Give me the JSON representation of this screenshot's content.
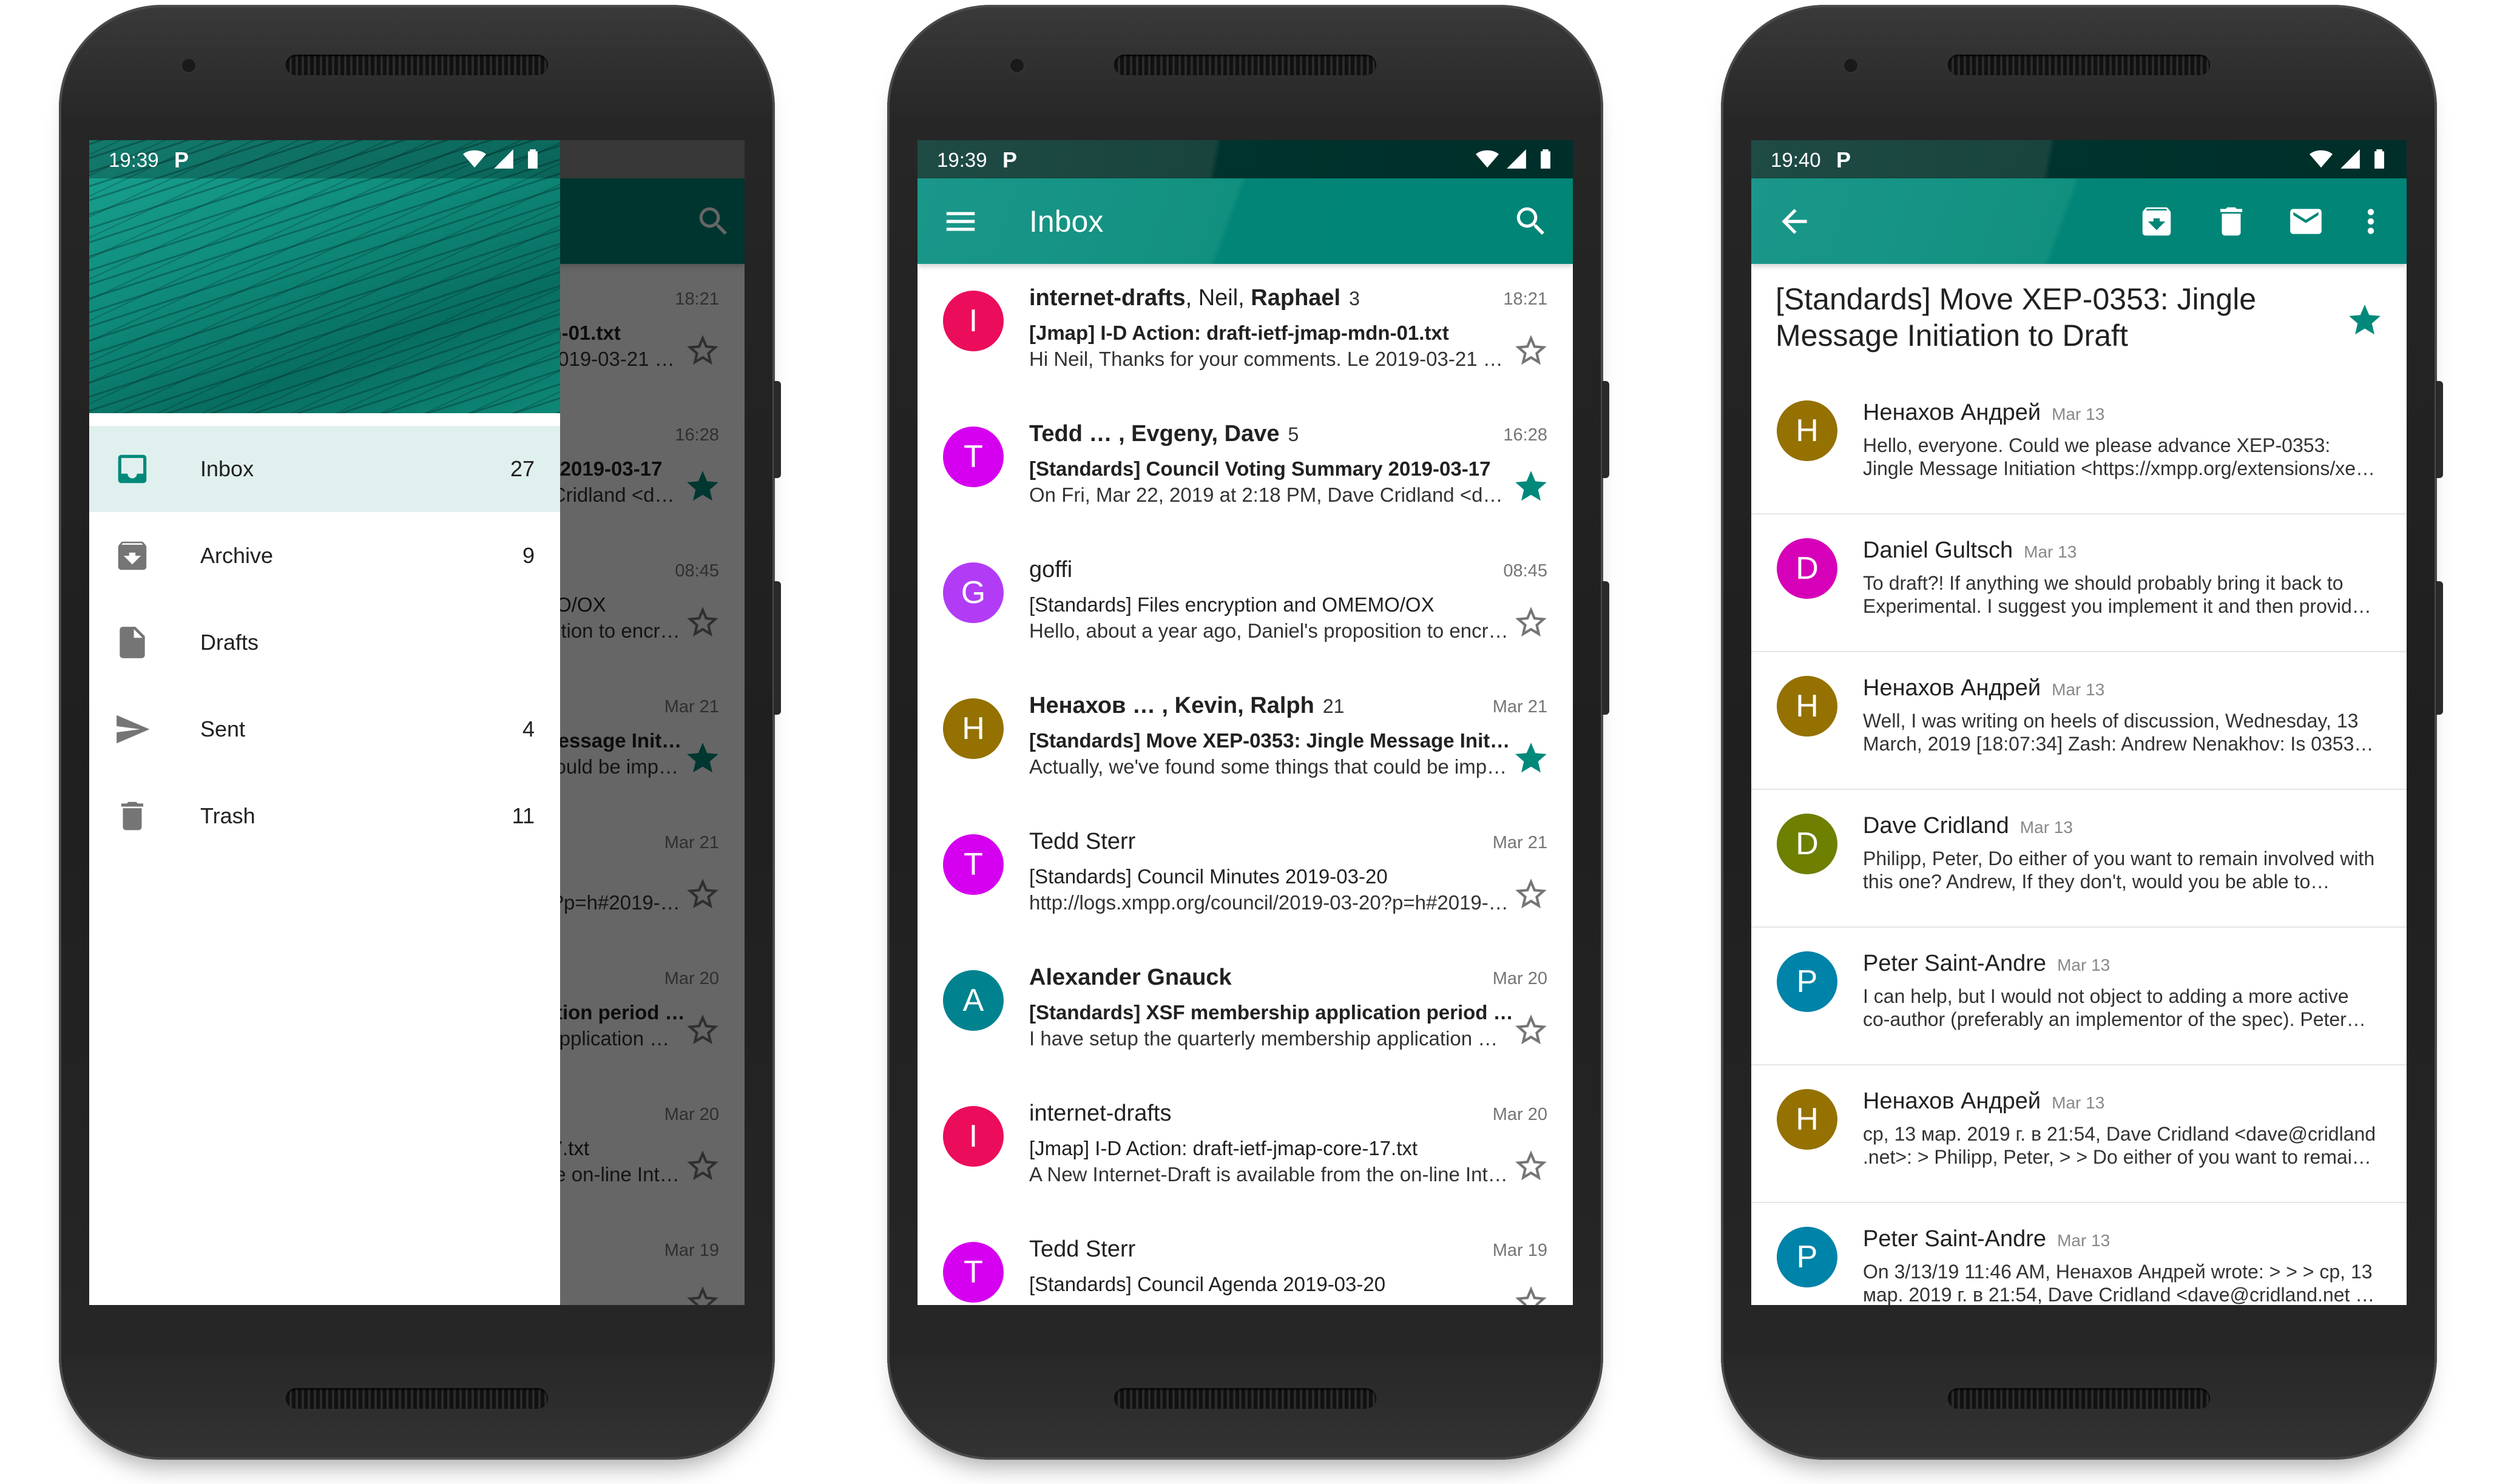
{
  "colors": {
    "primary": "#008577",
    "star": "#00897b",
    "star_empty": "#757575",
    "drawer_active": "#e0f0ee"
  },
  "phone1": {
    "status_time": "19:39"
  },
  "phone2": {
    "status_time": "19:39"
  },
  "phone3": {
    "status_time": "19:40"
  },
  "status_icons": [
    "wifi-icon",
    "signal-icon",
    "battery-icon"
  ],
  "status_app_icon": "P",
  "inbox": {
    "title": "Inbox",
    "menu_icon": "menu-icon",
    "search_icon": "search-icon",
    "items": [
      {
        "avatar": "I",
        "avatar_color": "#ec0c5c",
        "sender": [
          {
            "t": "internet-drafts",
            "b": true
          },
          {
            "t": ", Neil, ",
            "b": false
          },
          {
            "t": "Raphael",
            "b": true
          }
        ],
        "count": "3",
        "time": "18:21",
        "subject": "[Jmap] I-D Action: draft-ietf-jmap-mdn-01.txt",
        "unread": true,
        "preview": "Hi Neil, Thanks for your comments. Le 2019-03-21 16:…",
        "starred": false
      },
      {
        "avatar": "T",
        "avatar_color": "#d500f0",
        "sender": [
          {
            "t": "Tedd … , Evgeny, Dave",
            "b": true
          }
        ],
        "count": "5",
        "time": "16:28",
        "subject": "[Standards] Council Voting Summary 2019-03-17",
        "unread": true,
        "preview": " On Fri, Mar 22, 2019 at 2:18 PM, Dave Cridland <dave…",
        "starred": true
      },
      {
        "avatar": "G",
        "avatar_color": "#b23cf5",
        "sender": [
          {
            "t": "goffi",
            "b": false
          }
        ],
        "count": "",
        "time": "08:45",
        "subject": "[Standards] Files encryption and OMEMO/OX",
        "unread": false,
        "preview": "Hello, about a year ago, Daniel's proposition to encryp…",
        "starred": false
      },
      {
        "avatar": "H",
        "avatar_color": "#947100",
        "sender": [
          {
            "t": "Ненахов … , Kevin, Ralph",
            "b": true
          }
        ],
        "count": "21",
        "time": "Mar 21",
        "subject": "[Standards] Move XEP-0353: Jingle Message Initiatio…",
        "unread": true,
        "preview": "Actually, we've found some things that could be impr…",
        "starred": true
      },
      {
        "avatar": "T",
        "avatar_color": "#d500f0",
        "sender": [
          {
            "t": "Tedd Sterr",
            "b": false
          }
        ],
        "count": "",
        "time": "Mar 21",
        "subject": "[Standards] Council Minutes 2019-03-20",
        "unread": false,
        "preview": "http://logs.xmpp.org/council/2019-03-20?p=h#2019-…",
        "starred": false
      },
      {
        "avatar": "A",
        "avatar_color": "#00838f",
        "sender": [
          {
            "t": "Alexander Gnauck",
            "b": true
          }
        ],
        "count": "",
        "time": "Mar 20",
        "subject": "[Standards] XSF membership application period Q2 2…",
        "unread": true,
        "preview": "I have setup the quarterly membership application Wi…",
        "starred": false
      },
      {
        "avatar": "I",
        "avatar_color": "#ec0c5c",
        "sender": [
          {
            "t": "internet-drafts",
            "b": false
          }
        ],
        "count": "",
        "time": "Mar 20",
        "subject": "[Jmap] I-D Action: draft-ietf-jmap-core-17.txt",
        "unread": false,
        "preview": " A New Internet-Draft is available from the on-line Inte…",
        "starred": false
      },
      {
        "avatar": "T",
        "avatar_color": "#d500f0",
        "sender": [
          {
            "t": "Tedd Sterr",
            "b": false
          }
        ],
        "count": "",
        "time": "Mar 19",
        "subject": "[Standards] Council Agenda 2019-03-20",
        "unread": false,
        "preview": "",
        "starred": false
      }
    ]
  },
  "drawer": {
    "items": [
      {
        "label": "Inbox",
        "count": "27",
        "icon": "inbox-icon",
        "active": true
      },
      {
        "label": "Archive",
        "count": "9",
        "icon": "archive-icon",
        "active": false
      },
      {
        "label": "Drafts",
        "count": "",
        "icon": "drafts-icon",
        "active": false
      },
      {
        "label": "Sent",
        "count": "4",
        "icon": "send-icon",
        "active": false
      },
      {
        "label": "Trash",
        "count": "11",
        "icon": "trash-icon",
        "active": false
      }
    ]
  },
  "thread": {
    "toolbar_icons": [
      "back-arrow-icon",
      "archive-icon",
      "trash-icon",
      "mail-icon",
      "more-vert-icon"
    ],
    "subject": "[Standards] Move XEP-0353: Jingle Message Initiation to Draft",
    "starred": true,
    "messages": [
      {
        "avatar": "H",
        "avatar_color": "#947100",
        "sender": "Ненахов Андрей",
        "date": "Mar 13",
        "preview": "Hello, everyone. Could we please advance XEP-0353: Jingle Message Initiation <https://xmpp.org/extensions/xep-035…"
      },
      {
        "avatar": "D",
        "avatar_color": "#d600b8",
        "sender": "Daniel Gultsch",
        "date": "Mar 13",
        "preview": "To draft?! If anything we should probably bring it back to Experimental. I suggest you implement it and then provide …"
      },
      {
        "avatar": "H",
        "avatar_color": "#947100",
        "sender": "Ненахов Андрей",
        "date": "Mar 13",
        "preview": "Well, I was writing on heels of discussion, Wednesday, 13 March, 2019 [18:07:34] Zash: Andrew Nenakhov: Is 0353 i…"
      },
      {
        "avatar": "D",
        "avatar_color": "#6f7f00",
        "sender": "Dave Cridland",
        "date": "Mar 13",
        "preview": "Philipp, Peter, Do either of you want to remain involved with this one? Andrew, If they don't, would you be able to handl…"
      },
      {
        "avatar": "P",
        "avatar_color": "#0083a8",
        "sender": "Peter Saint-Andre",
        "date": "Mar 13",
        "preview": "I can help, but I would not object to adding a more active co-author (preferably an implementor of the spec). Peter O…"
      },
      {
        "avatar": "H",
        "avatar_color": "#947100",
        "sender": "Ненахов Андрей",
        "date": "Mar 13",
        "preview": "ср, 13 мар. 2019 г. в 21:54, Dave Cridland <dave@cridland .net>: > Philipp, Peter, > > Do either of you want to remain i…"
      },
      {
        "avatar": "P",
        "avatar_color": "#0083a8",
        "sender": "Peter Saint-Andre",
        "date": "Mar 13",
        "preview": "On 3/13/19 11:46 AM, Ненахов Андрей wrote: > > > ср, 13 мар. 2019 г. в 21:54, Dave Cridland <dave@cridland.net > …"
      }
    ]
  }
}
